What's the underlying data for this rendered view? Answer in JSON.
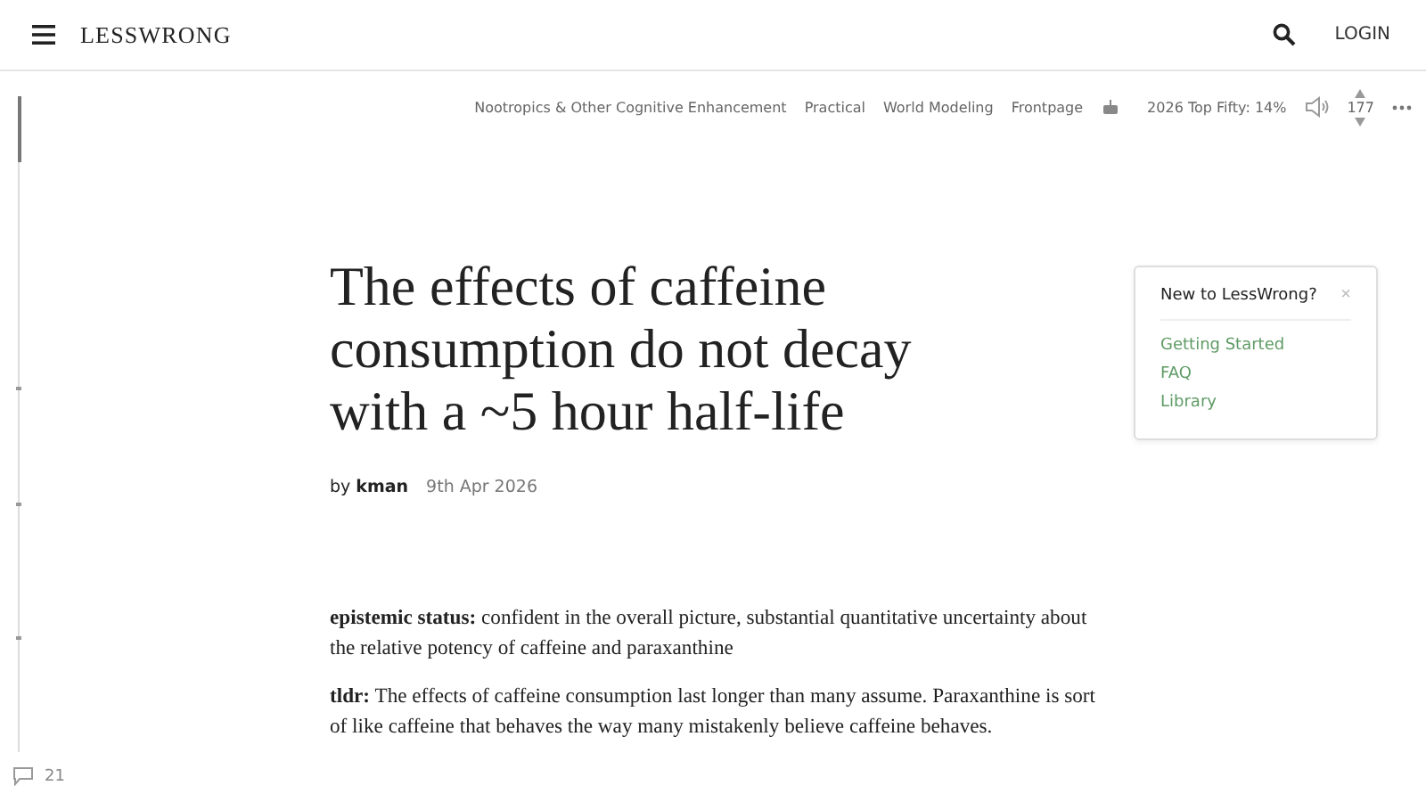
{
  "header": {
    "logo": "LESSWRONG",
    "login": "LOGIN"
  },
  "tags": [
    "Nootropics & Other Cognitive Enhancement",
    "Practical",
    "World Modeling",
    "Frontpage"
  ],
  "review": "2026 Top Fifty: 14%",
  "vote": {
    "score": "177"
  },
  "post": {
    "title": "The effects of caffeine consumption do not decay with a ~5 hour half-life",
    "by": "by",
    "author": "kman",
    "date": "9th Apr 2026",
    "paragraphs": [
      "**epistemic status:** confident in the overall picture, substantial quantitative uncertainty about the relative potency of caffeine and paraxanthine",
      "**tldr:** The effects of caffeine consumption last longer than many assume. Paraxanthine is sort of like caffeine that behaves the way many mistakenly believe caffeine behaves."
    ]
  },
  "comments": {
    "count": "21"
  },
  "welcome": {
    "title": "New to LessWrong?",
    "close": "×",
    "links": [
      "Getting Started",
      "FAQ",
      "Library"
    ]
  }
}
